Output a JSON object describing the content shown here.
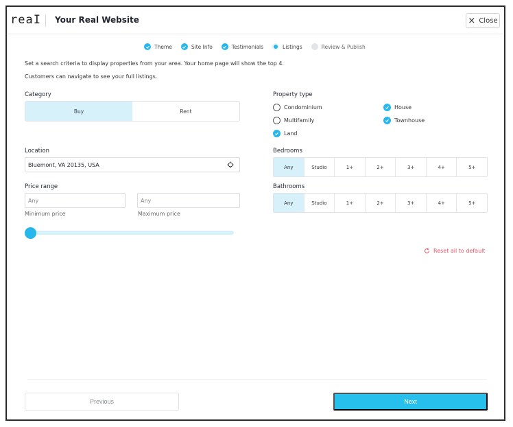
{
  "header": {
    "logo": "reaӀ",
    "title": "Your Real Website",
    "close_label": "Close"
  },
  "stepper": [
    {
      "label": "Theme",
      "state": "done"
    },
    {
      "label": "Site Info",
      "state": "done"
    },
    {
      "label": "Testimonials",
      "state": "done"
    },
    {
      "label": "Listings",
      "state": "current"
    },
    {
      "label": "Review & Publish",
      "state": "todo"
    }
  ],
  "intro": {
    "line1": "Set a search criteria to display properties from your area. Your home page will show the top 4.",
    "line2": "Customers can navigate to see your full listings."
  },
  "category": {
    "label": "Category",
    "options": [
      "Buy",
      "Rent"
    ],
    "selected": "Buy"
  },
  "location": {
    "label": "Location",
    "value": "Bluemont, VA 20135, USA"
  },
  "price": {
    "label": "Price range",
    "min_placeholder": "Any",
    "max_placeholder": "Any",
    "min_caption": "Minimum price",
    "max_caption": "Maximum price",
    "slider_fraction": 0
  },
  "property_type": {
    "label": "Property type",
    "items": [
      {
        "label": "Condominium",
        "checked": false
      },
      {
        "label": "House",
        "checked": true
      },
      {
        "label": "Multifamily",
        "checked": false
      },
      {
        "label": "Townhouse",
        "checked": true
      },
      {
        "label": "Land",
        "checked": true
      }
    ]
  },
  "bedrooms": {
    "label": "Bedrooms",
    "options": [
      "Any",
      "Studio",
      "1+",
      "2+",
      "3+",
      "4+",
      "5+"
    ],
    "selected": "Any"
  },
  "bathrooms": {
    "label": "Bathrooms",
    "options": [
      "Any",
      "Studio",
      "1+",
      "2+",
      "3+",
      "4+",
      "5+"
    ],
    "selected": "Any"
  },
  "reset_label": "Reset all to default",
  "footer": {
    "previous_label": "Previous",
    "next_label": "Next"
  },
  "colors": {
    "accent": "#27b7ea",
    "accent_light": "#d7f1fb",
    "danger": "#e25563"
  }
}
